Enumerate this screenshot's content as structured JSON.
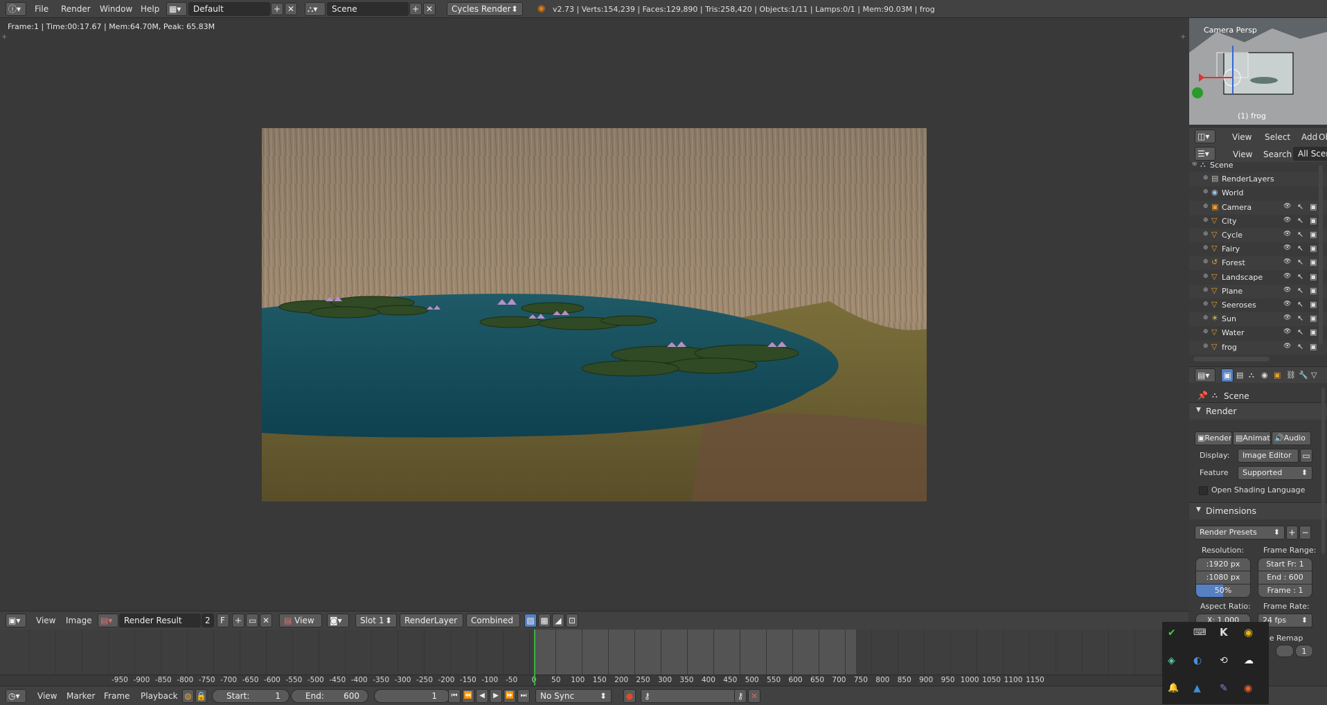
{
  "top_bar": {
    "menus": [
      "File",
      "Render",
      "Window",
      "Help"
    ],
    "layout_name": "Default",
    "scene_name": "Scene",
    "engine": "Cycles Render",
    "stats": "v2.73 | Verts:154,239 | Faces:129,890 | Tris:258,420 | Objects:1/11 | Lamps:0/1 | Mem:90.03M | frog"
  },
  "render_status": "Frame:1 | Time:00:17.67 | Mem:64.70M, Peak: 65.83M",
  "image_editor_header": {
    "menus": [
      "View",
      "Image"
    ],
    "image_name": "Render Result",
    "users": "2",
    "fake_user": "F",
    "view_label": "View",
    "slot": "Slot 1",
    "layer": "RenderLayer",
    "pass": "Combined"
  },
  "viewport": {
    "label": "Camera Persp",
    "object": "(1) frog"
  },
  "view3d_header": {
    "menus": [
      "View",
      "Select",
      "Add",
      "Ob"
    ]
  },
  "outliner": {
    "header": {
      "view": "View",
      "search": "Search",
      "filter": "All Scenes"
    },
    "items": [
      {
        "name": "Scene",
        "kind": "scene",
        "indent": 0
      },
      {
        "name": "RenderLayers",
        "kind": "layers",
        "indent": 1
      },
      {
        "name": "World",
        "kind": "world",
        "indent": 1
      },
      {
        "name": "Camera",
        "kind": "camera",
        "indent": 1
      },
      {
        "name": "City",
        "kind": "mesh",
        "indent": 1
      },
      {
        "name": "Cycle",
        "kind": "mesh",
        "indent": 1
      },
      {
        "name": "Fairy",
        "kind": "mesh",
        "indent": 1
      },
      {
        "name": "Forest",
        "kind": "curve",
        "indent": 1
      },
      {
        "name": "Landscape",
        "kind": "mesh",
        "indent": 1
      },
      {
        "name": "Plane",
        "kind": "mesh",
        "indent": 1
      },
      {
        "name": "Seeroses",
        "kind": "mesh",
        "indent": 1
      },
      {
        "name": "Sun",
        "kind": "lamp",
        "indent": 1
      },
      {
        "name": "Water",
        "kind": "mesh",
        "indent": 1
      },
      {
        "name": "frog",
        "kind": "mesh",
        "indent": 1
      }
    ]
  },
  "properties": {
    "context": "Scene",
    "render_section": "Render",
    "render_buttons": [
      "Render",
      "Animat",
      "Audio"
    ],
    "display_label": "Display:",
    "display_value": "Image Editor",
    "feature_label": "Feature",
    "feature_value": "Supported",
    "osl_label": "Open Shading Language",
    "dimensions_section": "Dimensions",
    "presets": "Render Presets",
    "resolution_label": "Resolution:",
    "res_x": ":1920 px",
    "res_y": ":1080 px",
    "res_pct": "50%",
    "frame_range_label": "Frame Range:",
    "start_frame": "Start Fr: 1",
    "end_frame": "End : 600",
    "frame_step": "Frame : 1",
    "aspect_label": "Aspect Ratio:",
    "aspect_x": "X: 1.000",
    "frame_rate_label": "Frame Rate:",
    "frame_rate": "24 fps",
    "time_remap": "me Remap",
    "remap_val": "1"
  },
  "timeline": {
    "ticks": [
      "-950",
      "-900",
      "-850",
      "-800",
      "-750",
      "-700",
      "-650",
      "-600",
      "-550",
      "-500",
      "-450",
      "-400",
      "-350",
      "-300",
      "-250",
      "-200",
      "-150",
      "-100",
      "-50",
      "0",
      "50",
      "100",
      "150",
      "200",
      "250",
      "300",
      "350",
      "400",
      "450",
      "500",
      "550",
      "600",
      "650",
      "700",
      "750",
      "800",
      "850",
      "900",
      "950",
      "1000",
      "1050",
      "1100",
      "1150"
    ],
    "current_frame": 0
  },
  "timeline_footer": {
    "menus": [
      "View",
      "Marker",
      "Frame",
      "Playback"
    ],
    "start_label": "Start:",
    "start_value": "1",
    "end_label": "End:",
    "end_value": "600",
    "current": "1",
    "sync": "No Sync"
  },
  "colors": {
    "accent": "#5680c2",
    "playhead": "#3ab13f",
    "bg": "#393939"
  }
}
